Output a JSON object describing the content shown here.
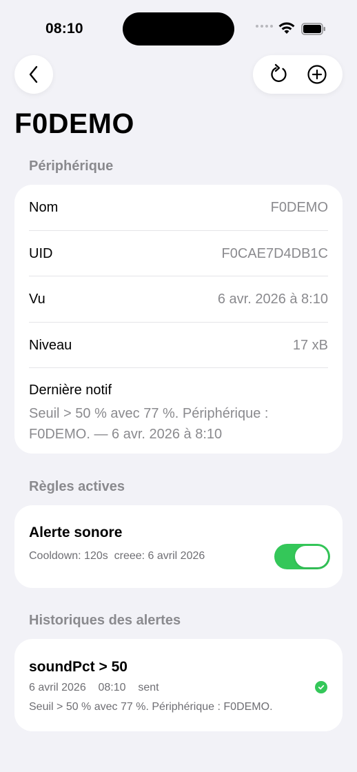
{
  "status_bar": {
    "time": "08:10"
  },
  "header": {
    "title": "F0DEMO"
  },
  "device_section": {
    "header": "Périphérique",
    "rows": [
      {
        "label": "Nom",
        "value": "F0DEMO"
      },
      {
        "label": "UID",
        "value": "F0CAE7D4DB1C"
      },
      {
        "label": "Vu",
        "value": "6 avr. 2026 à 8:10"
      },
      {
        "label": "Niveau",
        "value": "17 xB"
      }
    ],
    "last_notif_label": "Dernière notif",
    "last_notif_text": "Seuil > 50 % avec 77 %. Périphérique : F0DEMO. — 6 avr. 2026 à 8:10"
  },
  "rules_section": {
    "header": "Règles actives",
    "rule_title": "Alerte sonore",
    "rule_meta": "Cooldown: 120s  creee: 6 avril 2026",
    "toggle_on": true,
    "toggle_color": "#34c759"
  },
  "history_section": {
    "header": "Historiques des alertes",
    "title": "soundPct > 50",
    "meta": "6 avril 2026    08:10    sent",
    "message": "Seuil > 50 % avec 77 %. Périphérique : F0DEMO.",
    "status_icon": "check-circle-icon"
  },
  "colors": {
    "background": "#f2f2f7",
    "accent_green": "#34c759",
    "secondary_text": "#8a8a8e"
  }
}
